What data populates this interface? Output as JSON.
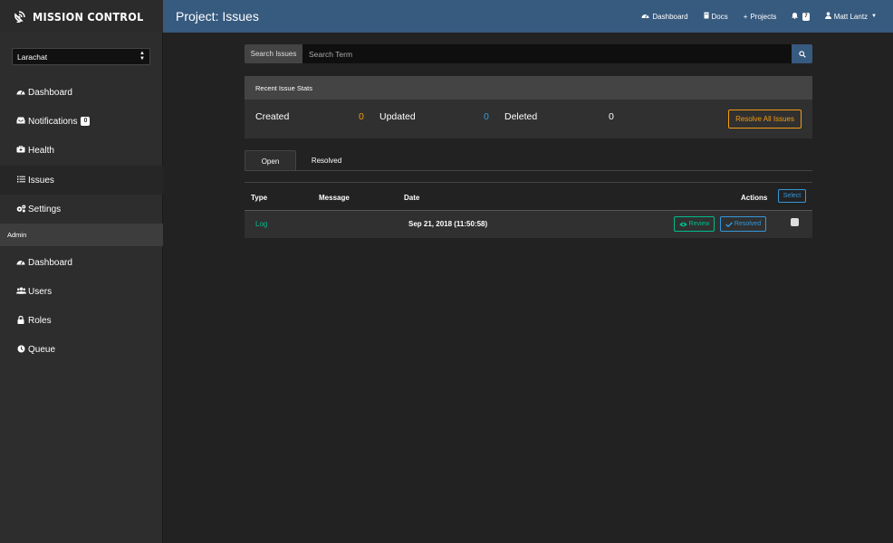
{
  "brand": {
    "name": "MISSION CONTROL"
  },
  "header": {
    "title": "Project: Issues",
    "nav": [
      {
        "label": "Dashboard",
        "icon": "dashboard-icon"
      },
      {
        "label": "Docs",
        "icon": "book-icon"
      },
      {
        "label": "Projects",
        "icon": "plus-icon"
      },
      {
        "label": "",
        "icon": "bell-icon",
        "badge": "7"
      },
      {
        "label": "Matt Lantz",
        "icon": "user-icon"
      }
    ]
  },
  "sidebar": {
    "project_select": "Larachat",
    "items": [
      {
        "label": "Dashboard",
        "icon": "dashboard-icon"
      },
      {
        "label": "Notifications",
        "icon": "inbox-icon",
        "badge": "0"
      },
      {
        "label": "Health",
        "icon": "medkit-icon"
      },
      {
        "label": "Issues",
        "icon": "list-icon"
      },
      {
        "label": "Settings",
        "icon": "gears-icon"
      }
    ],
    "admin_header": "Admin",
    "admin_items": [
      {
        "label": "Dashboard",
        "icon": "dashboard-icon"
      },
      {
        "label": "Users",
        "icon": "users-icon"
      },
      {
        "label": "Roles",
        "icon": "lock-icon"
      },
      {
        "label": "Queue",
        "icon": "clock-icon"
      }
    ]
  },
  "search": {
    "label": "Search Issues",
    "placeholder": "Search Term"
  },
  "stats": {
    "heading": "Recent Issue Stats",
    "created_label": "Created",
    "created_value": "0",
    "updated_label": "Updated",
    "updated_value": "0",
    "deleted_label": "Deleted",
    "deleted_value": "0",
    "resolve_all_label": "Resolve All Issues"
  },
  "tabs": [
    {
      "label": "Open"
    },
    {
      "label": "Resolved"
    }
  ],
  "table": {
    "columns": {
      "type": "Type",
      "message": "Message",
      "date": "Date",
      "actions": "Actions"
    },
    "select_label": "Select",
    "rows": [
      {
        "type": "Log",
        "message": "",
        "date": "Sep 21, 2018 (11:50:58)",
        "review_label": "Review",
        "resolved_label": "Resolved"
      }
    ]
  },
  "colors": {
    "topbar": "#375a7f",
    "success": "#00bc8c",
    "info": "#3498db",
    "warning": "#f39c12"
  }
}
